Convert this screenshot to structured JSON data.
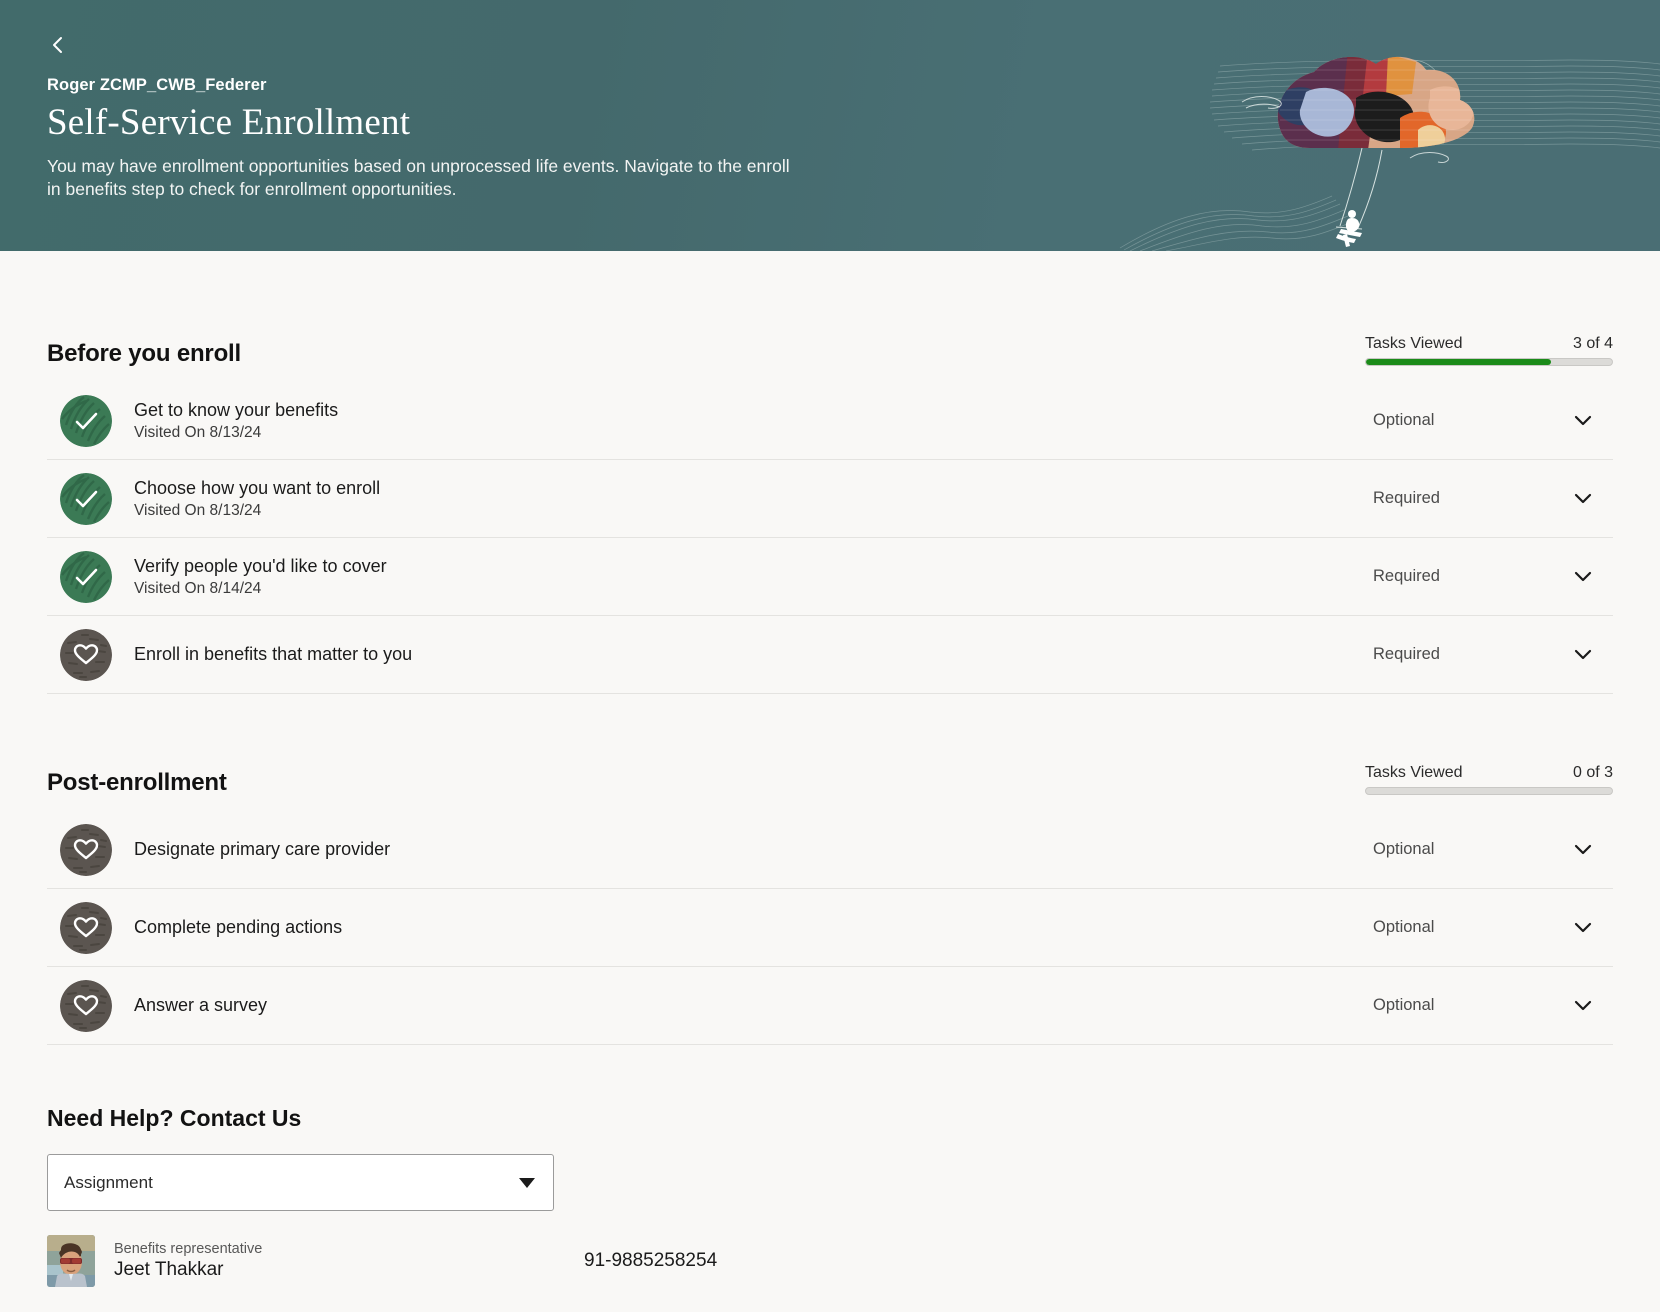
{
  "header": {
    "back_icon": "chevron-left-icon",
    "breadcrumb": "Roger ZCMP_CWB_Federer",
    "title": "Self-Service Enrollment",
    "description": "You may have enrollment opportunities based on unprocessed life events. Navigate to the enroll in benefits step to check for enrollment opportunities.",
    "illustration": "person-on-swing-under-cloud-illustration",
    "bg_color": "#44696c"
  },
  "sections": [
    {
      "title": "Before you enroll",
      "progress": {
        "label": "Tasks Viewed",
        "count_text": "3 of 4",
        "completed": 3,
        "total": 4,
        "fill_color": "#1b8b19"
      },
      "tasks": [
        {
          "icon": "green-check-circle-icon",
          "state": "done",
          "label": "Get to know your benefits",
          "sub": "Visited On 8/13/24",
          "status": "Optional",
          "chevron": "chevron-down-icon"
        },
        {
          "icon": "green-check-circle-icon",
          "state": "done",
          "label": "Choose how you want to enroll",
          "sub": "Visited On 8/13/24",
          "status": "Required",
          "chevron": "chevron-down-icon"
        },
        {
          "icon": "green-check-circle-icon",
          "state": "done",
          "label": "Verify people you'd like to cover",
          "sub": "Visited On 8/14/24",
          "status": "Required",
          "chevron": "chevron-down-icon"
        },
        {
          "icon": "gray-heart-circle-icon",
          "state": "pending",
          "label": "Enroll in benefits that matter to you",
          "sub": "",
          "status": "Required",
          "chevron": "chevron-down-icon"
        }
      ]
    },
    {
      "title": "Post-enrollment",
      "progress": {
        "label": "Tasks Viewed",
        "count_text": "0 of 3",
        "completed": 0,
        "total": 3,
        "fill_color": "#1b8b19"
      },
      "tasks": [
        {
          "icon": "gray-heart-circle-icon",
          "state": "pending",
          "label": "Designate primary care provider",
          "sub": "",
          "status": "Optional",
          "chevron": "chevron-down-icon"
        },
        {
          "icon": "gray-heart-circle-icon",
          "state": "pending",
          "label": "Complete pending actions",
          "sub": "",
          "status": "Optional",
          "chevron": "chevron-down-icon"
        },
        {
          "icon": "gray-heart-circle-icon",
          "state": "pending",
          "label": "Answer a survey",
          "sub": "",
          "status": "Optional",
          "chevron": "chevron-down-icon"
        }
      ]
    }
  ],
  "contact": {
    "title": "Need Help? Contact Us",
    "select": {
      "value": "Assignment",
      "caret_icon": "caret-down-icon"
    },
    "person": {
      "avatar": "representative-photo",
      "role": "Benefits representative",
      "name": "Jeet Thakkar",
      "phone": "91-9885258254"
    }
  }
}
